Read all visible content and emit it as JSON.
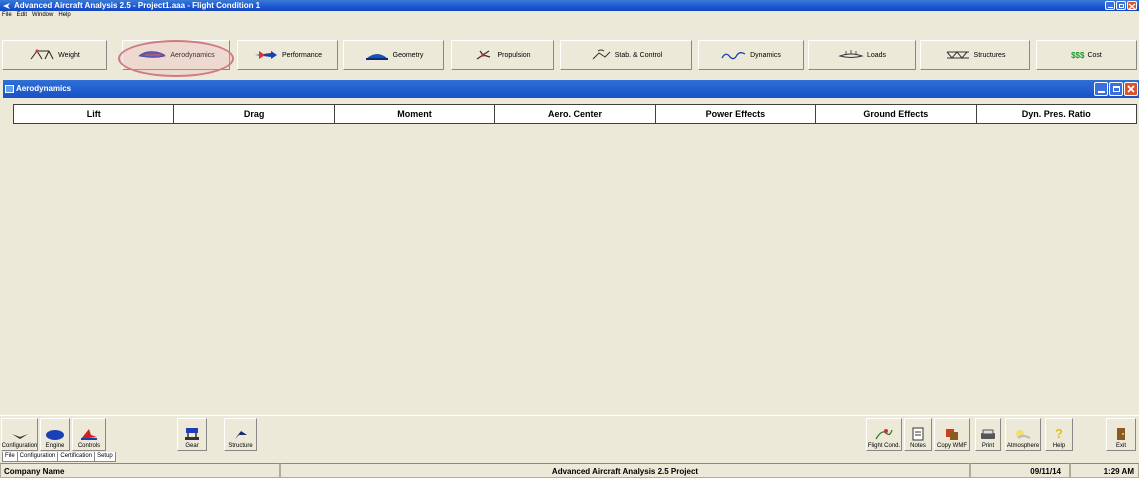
{
  "window": {
    "title": "Advanced Aircraft Analysis 2.5 - Project1.aaa - Flight Condition 1"
  },
  "menu": [
    "File",
    "Edit",
    "Window",
    "Help"
  ],
  "toolbar": {
    "buttons": [
      {
        "label": "Weight",
        "icon": "balance-scale-icon"
      },
      {
        "label": "Aerodynamics",
        "icon": "airfoil-icon",
        "highlighted": true
      },
      {
        "label": "Performance",
        "icon": "airplane-arrow-icon"
      },
      {
        "label": "Geometry",
        "icon": "fuselage-section-icon"
      },
      {
        "label": "Propulsion",
        "icon": "propeller-icon"
      },
      {
        "label": "Stab. & Control",
        "icon": "stability-icon"
      },
      {
        "label": "Dynamics",
        "icon": "response-curve-icon"
      },
      {
        "label": "Loads",
        "icon": "wing-loads-icon"
      },
      {
        "label": "Structures",
        "icon": "truss-icon"
      },
      {
        "label": "Cost",
        "icon": "dollar-signs-icon"
      }
    ]
  },
  "child_window": {
    "title": "Aerodynamics",
    "tabs": [
      "Lift",
      "Drag",
      "Moment",
      "Aero. Center",
      "Power Effects",
      "Ground Effects",
      "Dyn. Pres. Ratio"
    ]
  },
  "bottom_left_buttons": [
    {
      "label": "Configuration",
      "icon": "configuration-icon"
    },
    {
      "label": "Engine",
      "icon": "engine-icon"
    },
    {
      "label": "Controls",
      "icon": "controls-icon"
    },
    {
      "label": "Gear",
      "icon": "gear-icon"
    },
    {
      "label": "Structure",
      "icon": "structure-icon"
    }
  ],
  "bottom_right_buttons": [
    {
      "label": "Flight Cond.",
      "icon": "flight-condition-icon"
    },
    {
      "label": "Notes",
      "icon": "notes-icon"
    },
    {
      "label": "Copy WMF",
      "icon": "copy-wmf-icon"
    },
    {
      "label": "Print",
      "icon": "printer-icon"
    },
    {
      "label": "Atmosphere",
      "icon": "atmosphere-icon"
    },
    {
      "label": "Help",
      "icon": "help-icon"
    },
    {
      "label": "Exit",
      "icon": "exit-icon"
    }
  ],
  "sheet_tabs": [
    "File",
    "Configuration",
    "Certification",
    "Setup"
  ],
  "status": {
    "company": "Company Name",
    "project": "Advanced Aircraft Analysis 2.5 Project",
    "date": "09/11/14",
    "time": "1:29 AM"
  },
  "colors": {
    "titlebar": "#1b56d6",
    "highlight": "#d07a88",
    "background": "#ece9d8"
  }
}
